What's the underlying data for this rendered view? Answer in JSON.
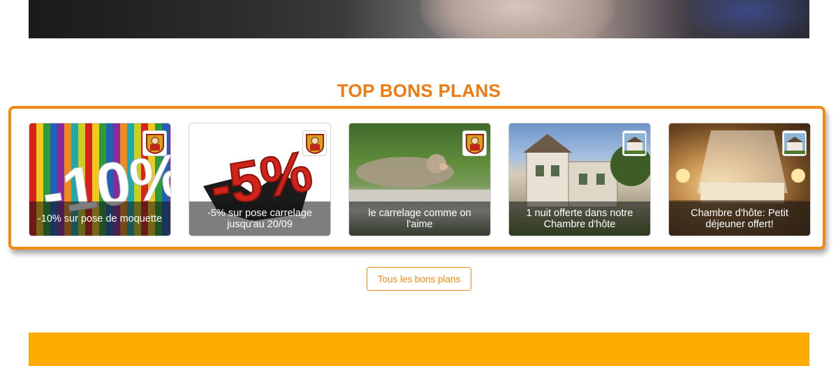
{
  "section": {
    "title": "TOP BONS PLANS"
  },
  "deals": [
    {
      "caption": "-10% sur pose de moquette",
      "badge_icon": "craftsman-logo-icon"
    },
    {
      "caption": "-5% sur pose carrelage jusqu'au 20/09",
      "badge_icon": "craftsman-logo-icon"
    },
    {
      "caption": "le carrelage comme on l'aime",
      "badge_icon": "craftsman-logo-icon"
    },
    {
      "caption": "1 nuit offerte dans notre Chambre d'hôte",
      "badge_icon": "guesthouse-logo-icon"
    },
    {
      "caption": "Chambre d'hôte: Petit déjeuner offert!",
      "badge_icon": "guesthouse-logo-icon"
    }
  ],
  "images": {
    "deal1_text": "-10%",
    "deal2_text": "-5%"
  },
  "button": {
    "all_deals_label": "Tous les bons plans"
  },
  "colors": {
    "accent": "#ef7a12",
    "footer": "#fdab00",
    "border": "#f18a12"
  }
}
